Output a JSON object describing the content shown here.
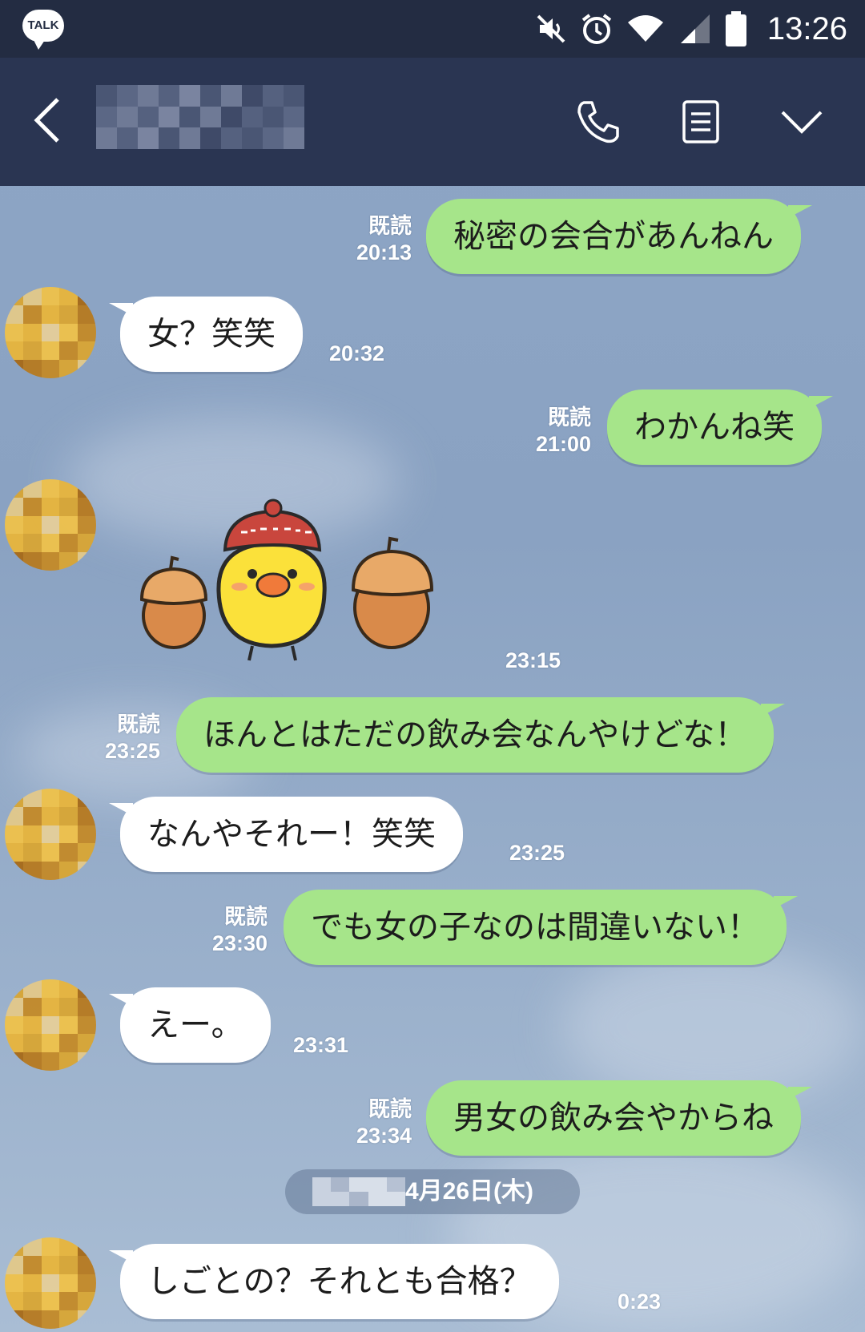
{
  "app": {
    "logo_text": "TALK"
  },
  "status_bar": {
    "time": "13:26",
    "icons": [
      "mute-icon",
      "alarm-icon",
      "wifi-icon",
      "signal-icon",
      "battery-icon"
    ]
  },
  "header": {
    "contact_name": "",
    "icons": [
      "back-icon",
      "phone-icon",
      "notes-icon",
      "chevron-down-icon"
    ]
  },
  "colors": {
    "status_bar_bg": "#232c42",
    "header_bg": "#2a3552",
    "chat_bg": "#8ea6c6",
    "outgoing_bubble": "#a6e58a",
    "incoming_bubble": "#ffffff"
  },
  "messages": [
    {
      "direction": "out",
      "text": "秘密の会合があんねん",
      "read": "既読",
      "time": "20:13"
    },
    {
      "direction": "in",
      "text": "女？笑笑",
      "time": "20:32"
    },
    {
      "direction": "out",
      "text": "わかんね笑",
      "read": "既読",
      "time": "21:00"
    },
    {
      "direction": "in",
      "sticker": "chick-with-acorns-sticker",
      "time": "23:15"
    },
    {
      "direction": "out",
      "text": "ほんとはただの飲み会なんやけどな！",
      "read": "既読",
      "time": "23:25"
    },
    {
      "direction": "in",
      "text": "なんやそれー！笑笑",
      "time": "23:25"
    },
    {
      "direction": "out",
      "text": "でも女の子なのは間違いない！",
      "read": "既読",
      "time": "23:30"
    },
    {
      "direction": "in",
      "text": "えー。",
      "time": "23:31"
    },
    {
      "direction": "out",
      "text": "男女の飲み会やからね",
      "read": "既読",
      "time": "23:34"
    },
    {
      "direction": "in",
      "text": "しごとの？それとも合格？",
      "time": "0:23"
    }
  ],
  "date_separator": {
    "text": "4月26日(木)"
  }
}
